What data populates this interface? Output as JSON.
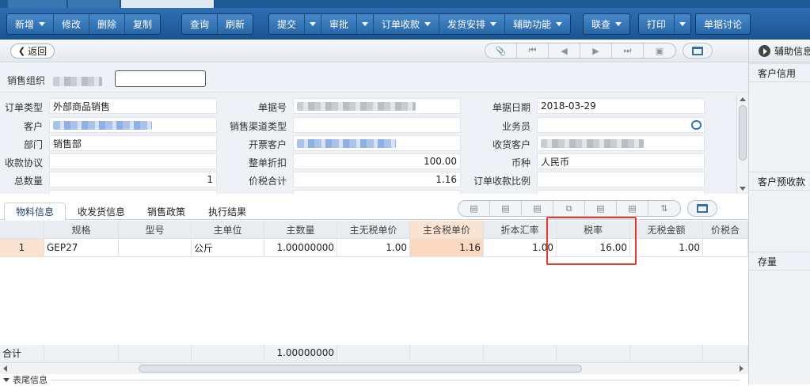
{
  "toolbar": {
    "groups": [
      [
        "新增",
        "修改",
        "删除",
        "复制"
      ],
      [
        "查询",
        "刷新"
      ],
      [
        "提交",
        "审批",
        "订单收款",
        "发货安排",
        "辅助功能"
      ],
      [
        "联查"
      ],
      [
        "打印"
      ],
      [
        "单据讨论"
      ]
    ]
  },
  "nav": {
    "back_label": "返回"
  },
  "org": {
    "label": "销售组织"
  },
  "form": {
    "labels": {
      "order_type": "订单类型",
      "customer": "客户",
      "dept": "部门",
      "collect_agreement": "收款协议",
      "total_qty": "总数量",
      "bill_no": "单据号",
      "channel_type": "销售渠道类型",
      "invoice_customer": "开票客户",
      "discount": "整单折扣",
      "tax_total": "价税合计",
      "bill_date": "单据日期",
      "salesman": "业务员",
      "receive_customer": "收货客户",
      "currency": "币种",
      "collect_ratio": "订单收款比例"
    },
    "values": {
      "order_type": "外部商品销售",
      "dept": "销售部",
      "total_qty": "1",
      "discount": "100.00",
      "tax_total": "1.16",
      "bill_date": "2018-03-29",
      "currency": "人民币"
    }
  },
  "tabs": [
    "物料信息",
    "收发货信息",
    "销售政策",
    "执行结果"
  ],
  "grid": {
    "headers": [
      "",
      "规格",
      "型号",
      "主单位",
      "主数量",
      "主无税单价",
      "主含税单价",
      "折本汇率",
      "税率",
      "无税金额",
      "价税合"
    ],
    "rows": [
      [
        "1",
        "GEP27",
        "",
        "公斤",
        "1.00000000",
        "1.00",
        "1.16",
        "1.00",
        "16.00",
        "1.00",
        ""
      ]
    ],
    "total_label": "合计",
    "total_qty": "1.00000000"
  },
  "footer": {
    "label": "表尾信息"
  },
  "side": {
    "header": "辅助信息",
    "sections": [
      "客户信用",
      "客户预收款",
      "存量"
    ]
  }
}
